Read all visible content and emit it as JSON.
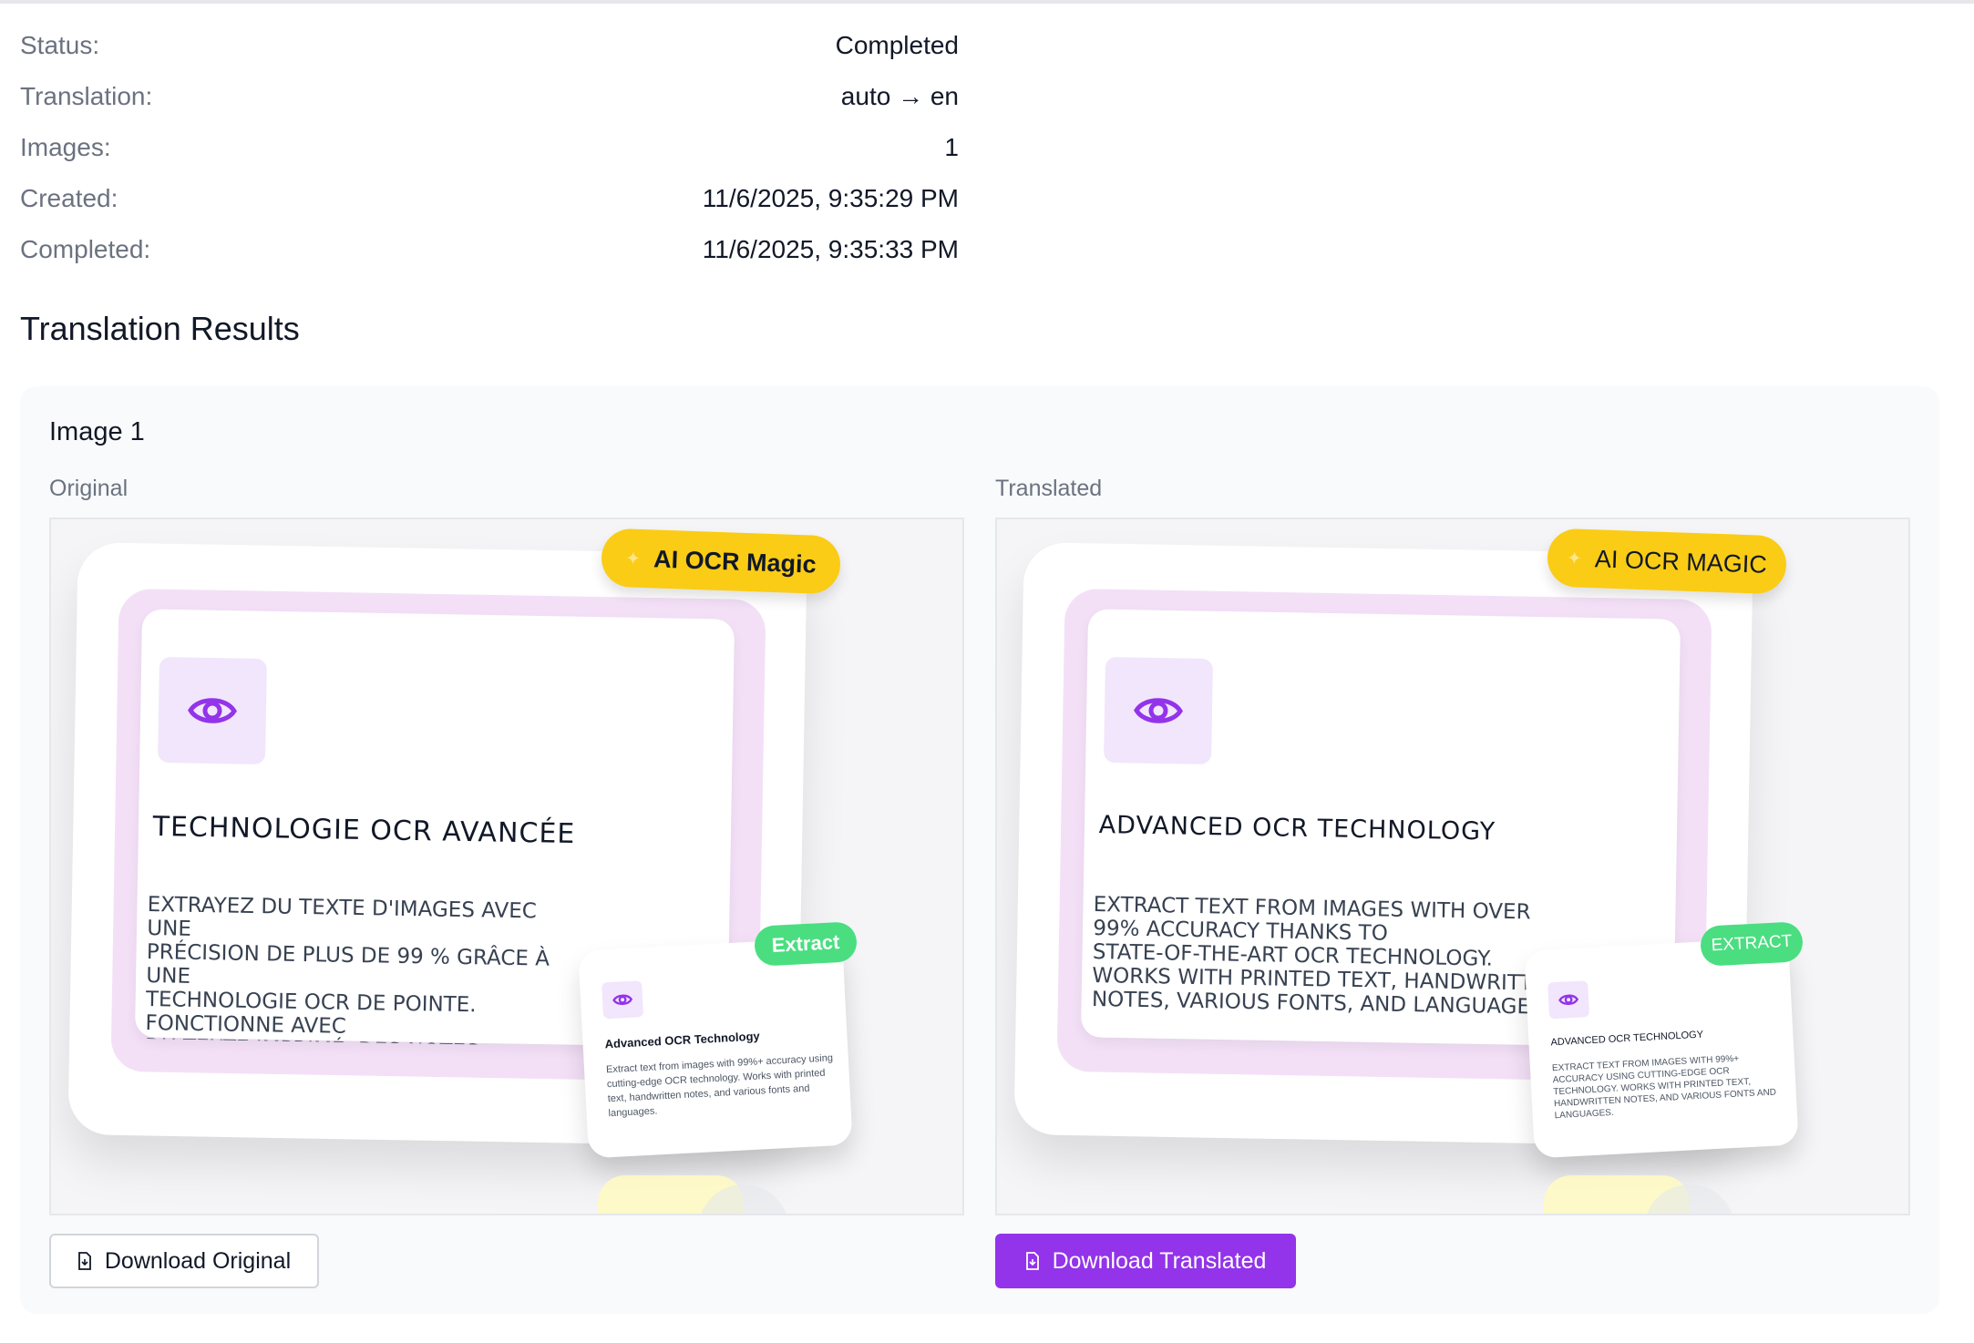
{
  "job_info": [
    {
      "label": "Status:",
      "value": "Completed"
    },
    {
      "label": "Translation:",
      "value": "auto → en"
    },
    {
      "label": "Images:",
      "value": "1"
    },
    {
      "label": "Created:",
      "value": "11/6/2025, 9:35:29 PM"
    },
    {
      "label": "Completed:",
      "value": "11/6/2025, 9:35:33 PM"
    }
  ],
  "results": {
    "section_title": "Translation Results",
    "image_title": "Image 1",
    "original": {
      "label": "Original",
      "badge": "AI OCR Magic",
      "heading": "TECHNOLOGIE OCR AVANCÉE",
      "body": "EXTRAYEZ DU TEXTE D'IMAGES AVEC UNE\nPRÉCISION DE PLUS DE 99 % GRÂCE À UNE\nTECHNOLOGIE OCR DE POINTE. FONCTIONNE AVEC\nDU TEXTE IMPRIMÉ, DES NOTES MANUSCRITES,\nDIVERSES POLICES ET LANGUES.",
      "extract_badge": "Extract",
      "mini_title": "Advanced OCR Technology",
      "mini_body": "Extract text from images with 99%+ accuracy using cutting-edge OCR technology. Works with printed text, handwritten notes, and various fonts and languages.",
      "download_label": "Download Original"
    },
    "translated": {
      "label": "Translated",
      "badge": "AI OCR MAGIC",
      "heading": "ADVANCED OCR TECHNOLOGY",
      "body": "EXTRACT TEXT FROM IMAGES WITH OVER\n99% ACCURACY THANKS TO\nSTATE-OF-THE-ART OCR TECHNOLOGY.\nWORKS WITH PRINTED TEXT, HANDWRITTEN\nNOTES, VARIOUS FONTS, AND LANGUAGES.",
      "extract_badge": "EXTRACT",
      "mini_title": "ADVANCED OCR TECHNOLOGY",
      "mini_body": "EXTRACT TEXT FROM IMAGES WITH 99%+ ACCURACY USING CUTTING-EDGE OCR TECHNOLOGY. WORKS WITH PRINTED TEXT, HANDWRITTEN NOTES, AND VARIOUS FONTS AND LANGUAGES.",
      "download_label": "Download Translated"
    }
  },
  "colors": {
    "accent": "#9333ea",
    "badge_yellow": "#facc15",
    "badge_green": "#4ade80",
    "eye_icon": "#9333ea"
  },
  "icons": {
    "eye": "eye-icon",
    "download": "file-download-icon"
  }
}
